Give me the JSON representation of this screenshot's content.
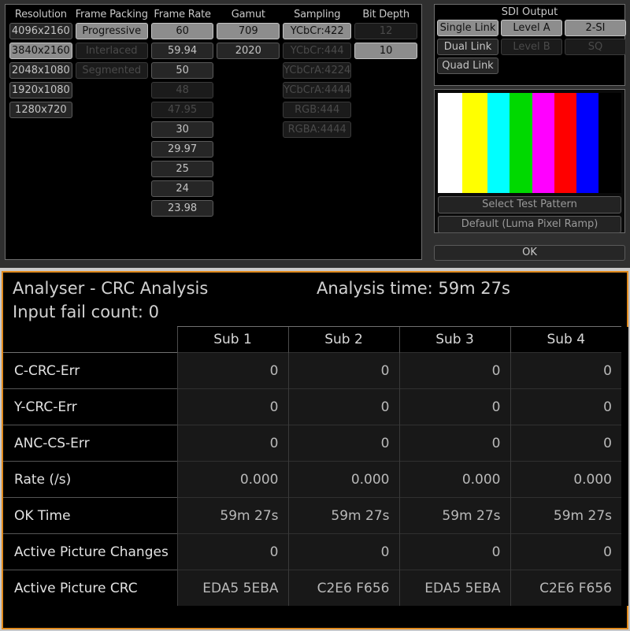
{
  "generator": {
    "columns": [
      {
        "header": "Resolution",
        "options": [
          {
            "label": "4096x2160",
            "state": "normal"
          },
          {
            "label": "3840x2160",
            "state": "selected"
          },
          {
            "label": "2048x1080",
            "state": "normal"
          },
          {
            "label": "1920x1080",
            "state": "normal"
          },
          {
            "label": "1280x720",
            "state": "normal"
          }
        ]
      },
      {
        "header": "Frame Packing",
        "options": [
          {
            "label": "Progressive",
            "state": "selected"
          },
          {
            "label": "Interlaced",
            "state": "disabled"
          },
          {
            "label": "Segmented",
            "state": "disabled"
          }
        ]
      },
      {
        "header": "Frame Rate",
        "options": [
          {
            "label": "60",
            "state": "selected"
          },
          {
            "label": "59.94",
            "state": "normal"
          },
          {
            "label": "50",
            "state": "normal"
          },
          {
            "label": "48",
            "state": "disabled"
          },
          {
            "label": "47.95",
            "state": "disabled"
          },
          {
            "label": "30",
            "state": "normal"
          },
          {
            "label": "29.97",
            "state": "normal"
          },
          {
            "label": "25",
            "state": "normal"
          },
          {
            "label": "24",
            "state": "normal"
          },
          {
            "label": "23.98",
            "state": "normal"
          }
        ]
      },
      {
        "header": "Gamut",
        "options": [
          {
            "label": "709",
            "state": "selected"
          },
          {
            "label": "2020",
            "state": "normal"
          }
        ]
      },
      {
        "header": "Sampling",
        "options": [
          {
            "label": "YCbCr:422",
            "state": "selected"
          },
          {
            "label": "YCbCr:444",
            "state": "disabled"
          },
          {
            "label": "YCbCrA:4224",
            "state": "disabled"
          },
          {
            "label": "YCbCrA:4444",
            "state": "disabled"
          },
          {
            "label": "RGB:444",
            "state": "disabled"
          },
          {
            "label": "RGBA:4444",
            "state": "disabled"
          }
        ]
      },
      {
        "header": "Bit Depth",
        "options": [
          {
            "label": "12",
            "state": "disabled"
          },
          {
            "label": "10",
            "state": "selected"
          }
        ]
      }
    ]
  },
  "sdi_output": {
    "title": "SDI Output",
    "buttons": [
      {
        "label": "Single Link",
        "state": "selected"
      },
      {
        "label": "Level A",
        "state": "selected"
      },
      {
        "label": "2-SI",
        "state": "selected"
      },
      {
        "label": "Dual Link",
        "state": "normal"
      },
      {
        "label": "Level B",
        "state": "disabled"
      },
      {
        "label": "SQ",
        "state": "disabled"
      },
      {
        "label": "Quad Link",
        "state": "normal"
      },
      {
        "label": "",
        "state": "spacer"
      },
      {
        "label": "",
        "state": "spacer"
      }
    ]
  },
  "test_pattern": {
    "bars": [
      {
        "name": "white",
        "color": "#ffffff",
        "width": 13.5
      },
      {
        "name": "yellow",
        "color": "#ffff00",
        "width": 13.5
      },
      {
        "name": "cyan",
        "color": "#00ffff",
        "width": 12.0
      },
      {
        "name": "green",
        "color": "#00d900",
        "width": 12.5
      },
      {
        "name": "magenta",
        "color": "#ff00ff",
        "width": 12.0
      },
      {
        "name": "red",
        "color": "#ff0000",
        "width": 12.0
      },
      {
        "name": "blue",
        "color": "#0000ff",
        "width": 12.0
      },
      {
        "name": "black",
        "color": "#000000",
        "width": 12.5
      }
    ],
    "select_label": "Select Test Pattern",
    "current_label": "Default (Luma Pixel Ramp)"
  },
  "ok_label": "OK",
  "analyser": {
    "title": "Analyser - CRC Analysis",
    "analysis_time": "Analysis time: 59m 27s",
    "input_fail": "Input fail count:  0",
    "columns": [
      "Sub 1",
      "Sub 2",
      "Sub 3",
      "Sub 4"
    ],
    "rows": [
      {
        "label": "C-CRC-Err",
        "values": [
          "0",
          "0",
          "0",
          "0"
        ]
      },
      {
        "label": "Y-CRC-Err",
        "values": [
          "0",
          "0",
          "0",
          "0"
        ]
      },
      {
        "label": "ANC-CS-Err",
        "values": [
          "0",
          "0",
          "0",
          "0"
        ]
      },
      {
        "label": "Rate (/s)",
        "values": [
          "0.000",
          "0.000",
          "0.000",
          "0.000"
        ]
      },
      {
        "label": "OK Time",
        "values": [
          "59m 27s",
          "59m 27s",
          "59m 27s",
          "59m 27s"
        ]
      },
      {
        "label": "Active Picture Changes",
        "values": [
          "0",
          "0",
          "0",
          "0"
        ]
      },
      {
        "label": "Active Picture CRC",
        "values": [
          "EDA5 5EBA",
          "C2E6 F656",
          "EDA5 5EBA",
          "C2E6 F656"
        ]
      }
    ]
  },
  "colors": {
    "accent_border": "#e08a1e",
    "panel_bg": "#000000",
    "button_bg": "#262626",
    "button_selected_bg": "#8d8d8d"
  }
}
